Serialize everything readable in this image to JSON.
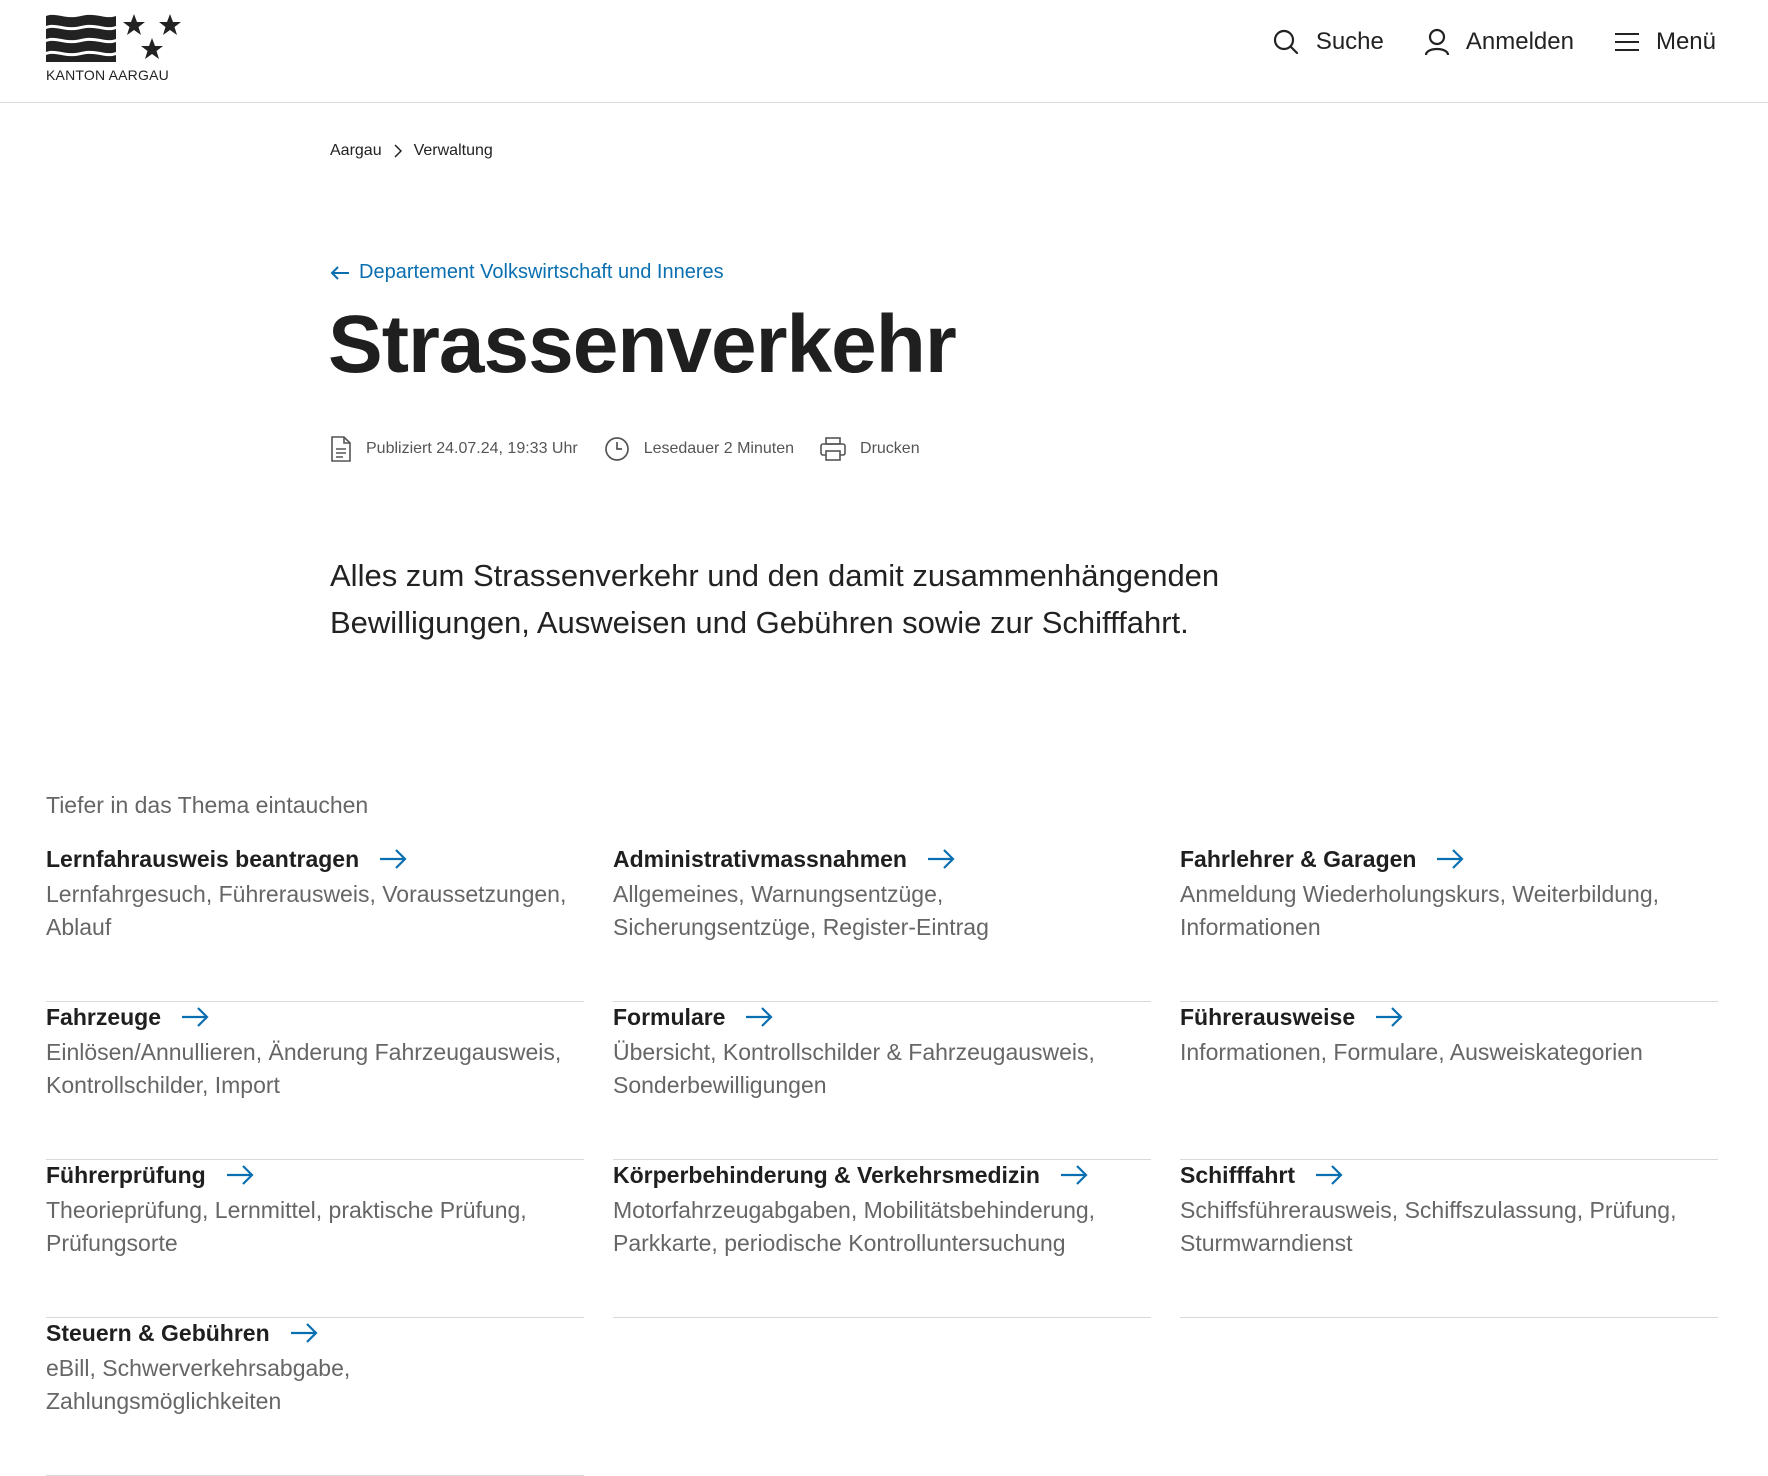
{
  "header": {
    "logo_text": "KANTON AARGAU",
    "nav": [
      {
        "label": "Suche",
        "icon": "search-icon"
      },
      {
        "label": "Anmelden",
        "icon": "user-icon"
      },
      {
        "label": "Menü",
        "icon": "hamburger-menu-icon"
      }
    ]
  },
  "breadcrumb": [
    "Aargau",
    "Verwaltung"
  ],
  "back_link": "Departement Volkswirtschaft und Inneres",
  "title": "Strassenverkehr",
  "meta": {
    "published": "Publiziert 24.07.24, 19:33 Uhr",
    "reading_time": "Lesedauer 2 Minuten",
    "print": "Drucken"
  },
  "lead": "Alles zum Strassenverkehr und den damit zusammenhängenden Bewilligungen, Ausweisen und Gebühren sowie zur Schifffahrt.",
  "section_title": "Tiefer in das Thema eintauchen",
  "cards": [
    {
      "title": "Lernfahrausweis beantragen",
      "desc": "Lernfahrgesuch, Führerausweis, Voraussetzungen, Ablauf"
    },
    {
      "title": "Administrativmassnahmen",
      "desc": "Allgemeines, Warnungsentzüge, Sicherungsentzüge, Register-Eintrag"
    },
    {
      "title": "Fahrlehrer & Garagen",
      "desc": "Anmeldung Wiederholungskurs, Weiterbildung, Informationen"
    },
    {
      "title": "Fahrzeuge",
      "desc": "Einlösen/Annullieren, Änderung Fahrzeugausweis, Kontrollschilder, Import"
    },
    {
      "title": "Formulare",
      "desc": "Übersicht, Kontrollschilder & Fahrzeugausweis, Sonderbewilligungen"
    },
    {
      "title": "Führerausweise",
      "desc": "Informationen, Formulare, Ausweiskategorien"
    },
    {
      "title": "Führerprüfung",
      "desc": "Theorieprüfung, Lernmittel, praktische Prüfung, Prüfungsorte"
    },
    {
      "title": "Körperbehinderung & Verkehrsmedizin",
      "desc": "Motorfahrzeugabgaben, Mobilitätsbehinderung, Parkkarte, periodische Kontrolluntersuchung"
    },
    {
      "title": "Schifffahrt",
      "desc": "Schiffsführerausweis, Schiffszulassung, Prüfung, Sturmwarndienst"
    },
    {
      "title": "Steuern & Gebühren",
      "desc": "eBill, Schwerverkehrsabgabe, Zahlungsmöglichkeiten"
    }
  ],
  "colors": {
    "accent": "#0a6fb0",
    "text": "#222222",
    "muted": "#666666",
    "divider": "#d9d9d9"
  }
}
